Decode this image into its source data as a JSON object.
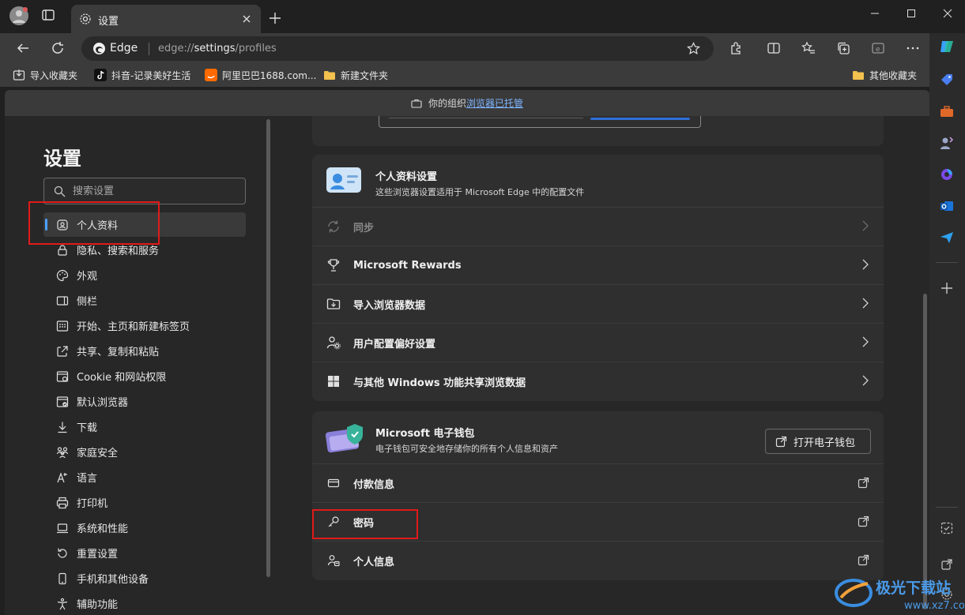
{
  "tab": {
    "title": "设置"
  },
  "address": {
    "site_label": "Edge",
    "url_prefix": "edge://",
    "url_main": "settings",
    "url_suffix": "/profiles"
  },
  "bookmarks": [
    {
      "label": "导入收藏夹"
    },
    {
      "label": "抖音-记录美好生活"
    },
    {
      "label": "阿里巴巴1688.com..."
    },
    {
      "label": "新建文件夹"
    }
  ],
  "bookmarks_other": "其他收藏夹",
  "managed_banner": {
    "text": "你的组织",
    "link": "浏览器已托管"
  },
  "settings": {
    "title": "设置",
    "search_placeholder": "搜索设置",
    "nav": [
      {
        "label": "个人资料",
        "icon": "profile-icon"
      },
      {
        "label": "隐私、搜索和服务",
        "icon": "lock-icon"
      },
      {
        "label": "外观",
        "icon": "palette-icon"
      },
      {
        "label": "侧栏",
        "icon": "sidebar-icon"
      },
      {
        "label": "开始、主页和新建标签页",
        "icon": "home-icon"
      },
      {
        "label": "共享、复制和粘贴",
        "icon": "share-icon"
      },
      {
        "label": "Cookie 和网站权限",
        "icon": "cookie-icon"
      },
      {
        "label": "默认浏览器",
        "icon": "browser-icon"
      },
      {
        "label": "下载",
        "icon": "download-icon"
      },
      {
        "label": "家庭安全",
        "icon": "family-icon"
      },
      {
        "label": "语言",
        "icon": "language-icon"
      },
      {
        "label": "打印机",
        "icon": "printer-icon"
      },
      {
        "label": "系统和性能",
        "icon": "laptop-icon"
      },
      {
        "label": "重置设置",
        "icon": "reset-icon"
      },
      {
        "label": "手机和其他设备",
        "icon": "phone-icon"
      },
      {
        "label": "辅助功能",
        "icon": "accessibility-icon"
      }
    ]
  },
  "profile_card": {
    "title": "个人资料设置",
    "subtitle": "这些浏览器设置适用于 Microsoft Edge 中的配置文件",
    "rows": [
      {
        "label": "同步"
      },
      {
        "label": "Microsoft Rewards"
      },
      {
        "label": "导入浏览器数据"
      },
      {
        "label": "用户配置偏好设置"
      },
      {
        "label": "与其他 Windows 功能共享浏览数据"
      }
    ]
  },
  "wallet_card": {
    "title": "Microsoft 电子钱包",
    "subtitle": "电子钱包可安全地存储你的所有个人信息和资产",
    "open_button": "打开电子钱包",
    "rows": [
      {
        "label": "付款信息"
      },
      {
        "label": "密码"
      },
      {
        "label": "个人信息"
      }
    ]
  },
  "colors": {
    "accent": "#4ca0ff",
    "highlight_box": "#e01b1b"
  }
}
